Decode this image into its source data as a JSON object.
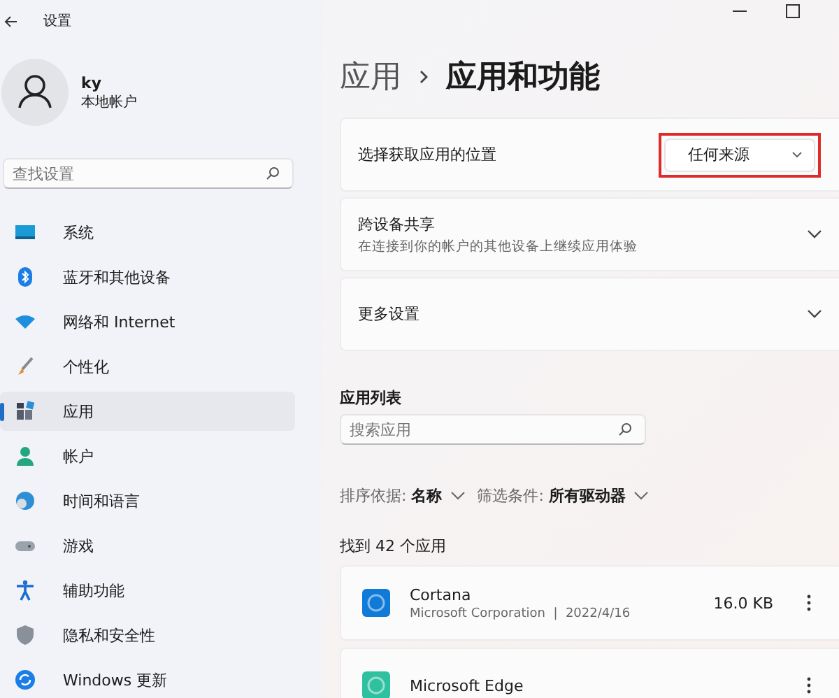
{
  "window": {
    "title": "设置"
  },
  "profile": {
    "name": "ky",
    "account": "本地帐户"
  },
  "sidebar": {
    "search": {
      "placeholder": "查找设置"
    },
    "items": [
      {
        "label": "系统",
        "kind": "system",
        "selected": false
      },
      {
        "label": "蓝牙和其他设备",
        "kind": "bluetooth",
        "selected": false
      },
      {
        "label": "网络和 Internet",
        "kind": "network",
        "selected": false
      },
      {
        "label": "个性化",
        "kind": "brush",
        "selected": false
      },
      {
        "label": "应用",
        "kind": "apps",
        "selected": true
      },
      {
        "label": "帐户",
        "kind": "account",
        "selected": false
      },
      {
        "label": "时间和语言",
        "kind": "time",
        "selected": false
      },
      {
        "label": "游戏",
        "kind": "gaming",
        "selected": false
      },
      {
        "label": "辅助功能",
        "kind": "accessibility",
        "selected": false
      },
      {
        "label": "隐私和安全性",
        "kind": "privacy",
        "selected": false
      },
      {
        "label": "Windows 更新",
        "kind": "update",
        "selected": false
      }
    ]
  },
  "breadcrumb": {
    "parent": "应用",
    "current": "应用和功能"
  },
  "settings": [
    {
      "kind": "dropdown",
      "label": "选择获取应用的位置",
      "value": "任何来源",
      "highlighted": true
    },
    {
      "kind": "expander",
      "label": "跨设备共享",
      "description": "在连接到你的帐户的其他设备上继续应用体验"
    },
    {
      "kind": "expander",
      "label": "更多设置"
    }
  ],
  "app_list": {
    "heading": "应用列表",
    "search": {
      "placeholder": "搜索应用"
    },
    "sort": "排序依据: **名称**",
    "filter": "筛选条件: **所有驱动器**",
    "count": "找到 42 个应用",
    "apps": [
      {
        "name": "Cortana",
        "details": "Microsoft Corporation  |  2022/4/16",
        "size": "16.0 KB",
        "color": "#0f7ad8"
      },
      {
        "name": "Microsoft Edge",
        "color": "#2fc0a0"
      }
    ]
  }
}
